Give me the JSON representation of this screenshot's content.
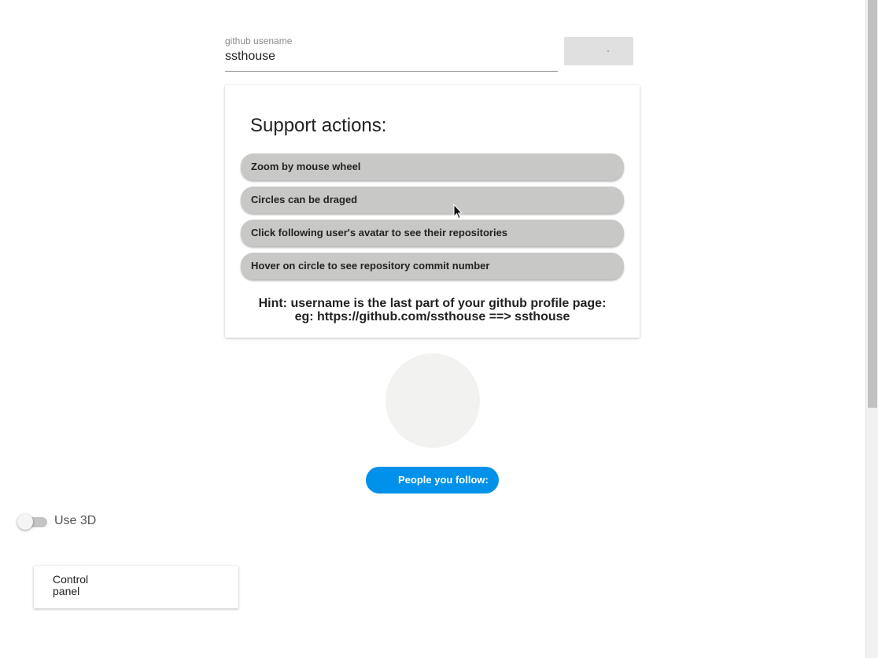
{
  "search": {
    "label": "github usename",
    "value": "ssthouse"
  },
  "support": {
    "title": "Support actions:",
    "actions": [
      "Zoom by mouse wheel",
      "Circles can be draged",
      "Click following user's avatar to see their repositories",
      "Hover on circle to see repository commit number"
    ],
    "hint_line1": "Hint: username is the last part of your github profile page:",
    "hint_line2": "eg: https://github.com/ssthouse ==> ssthouse"
  },
  "follow_button": "People you follow:",
  "toggle": {
    "label": "Use 3D",
    "checked": false
  },
  "control_panel": "Control panel",
  "colors": {
    "accent": "#0091ea",
    "chip": "#c8c8c6",
    "avatar_placeholder": "#f2f2f1"
  }
}
